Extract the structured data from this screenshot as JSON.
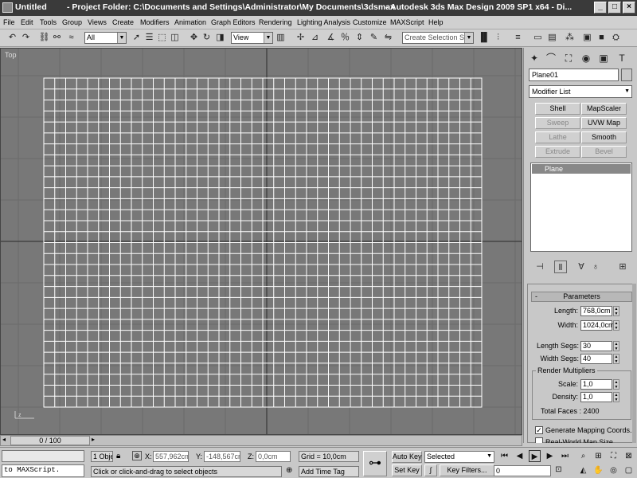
{
  "title": {
    "doc": "Untitled",
    "project": "- Project Folder: C:\\Documents and Settings\\Administrator\\My Documents\\3dsmax",
    "app": "- Autodesk 3ds Max Design 2009 SP1   x64     - Di..."
  },
  "window_buttons": {
    "minimize": "_",
    "maximize": "□",
    "close": "×"
  },
  "menu": [
    "File",
    "Edit",
    "Tools",
    "Group",
    "Views",
    "Create",
    "Modifiers",
    "Animation",
    "Graph Editors",
    "Rendering",
    "Lighting Analysis",
    "Customize",
    "MAXScript",
    "Help"
  ],
  "toolbar": {
    "selection_filter": "All",
    "reference_coord": "View",
    "named_selection": "Create Selection Set"
  },
  "viewport": {
    "label": "Top",
    "grid_cols": 40,
    "grid_rows": 30,
    "axis_label": "z"
  },
  "command_panel": {
    "object_name": "Plane01",
    "modifier_list": "Modifier List",
    "buttons": [
      {
        "label": "Shell",
        "enabled": true
      },
      {
        "label": "MapScaler",
        "enabled": true
      },
      {
        "label": "Sweep",
        "enabled": false
      },
      {
        "label": "UVW Map",
        "enabled": true
      },
      {
        "label": "Lathe",
        "enabled": false
      },
      {
        "label": "Smooth",
        "enabled": true
      },
      {
        "label": "Extrude",
        "enabled": false
      },
      {
        "label": "Bevel",
        "enabled": false
      }
    ],
    "stack_item": "Plane",
    "rollout_title": "Parameters",
    "rollout_toggle": "-",
    "length_label": "Length:",
    "length_value": "768,0cm",
    "width_label": "Width:",
    "width_value": "1024,0cm",
    "length_segs_label": "Length Segs:",
    "length_segs_value": "30",
    "width_segs_label": "Width Segs:",
    "width_segs_value": "40",
    "render_multipliers": "Render Multipliers",
    "scale_label": "Scale:",
    "scale_value": "1,0",
    "density_label": "Density:",
    "density_value": "1,0",
    "total_faces": "Total Faces : 2400",
    "gen_mapping": "Generate Mapping Coords.",
    "real_world": "Real-World Map Size"
  },
  "timeline": {
    "frame": "0 / 100"
  },
  "status": {
    "maxscript": "to MAXScript.",
    "selected_count": "1 Obje",
    "x_label": "X:",
    "x_value": "557,962cm",
    "y_label": "Y:",
    "y_value": "-148,567cm",
    "z_label": "Z:",
    "z_value": "0,0cm",
    "grid": "Grid = 10,0cm",
    "prompt": "Click or click-and-drag to select objects",
    "add_time_tag": "Add Time Tag",
    "auto_key": "Auto Key",
    "set_key": "Set Key",
    "key_mode": "Selected",
    "key_filters": "Key Filters...",
    "current_frame": "0"
  }
}
